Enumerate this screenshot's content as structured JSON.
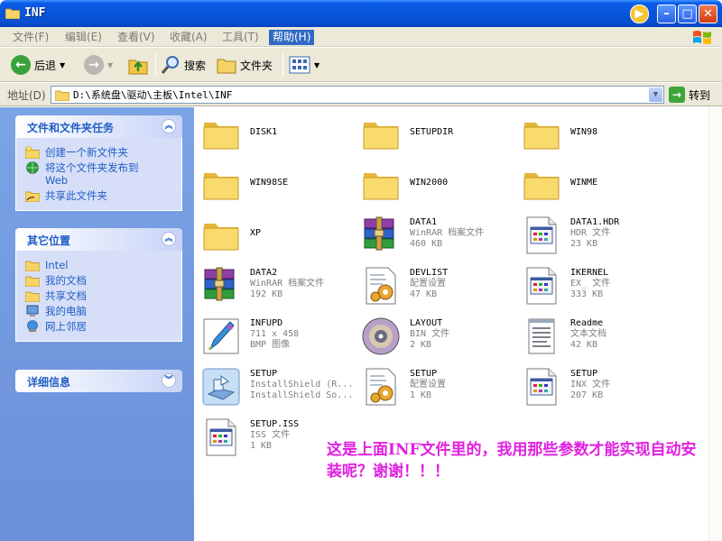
{
  "window": {
    "title": "INF"
  },
  "menu": [
    {
      "label": "文件(F)"
    },
    {
      "label": "编辑(E)"
    },
    {
      "label": "查看(V)"
    },
    {
      "label": "收藏(A)"
    },
    {
      "label": "工具(T)"
    },
    {
      "label": "帮助(H)"
    }
  ],
  "toolbar": {
    "back": "后退",
    "search": "搜索",
    "folders": "文件夹"
  },
  "address": {
    "label": "地址(D)",
    "path": "D:\\系统盘\\驱动\\主板\\Intel\\INF",
    "go": "转到"
  },
  "tasks_panel": {
    "title": "文件和文件夹任务",
    "items": [
      {
        "label": "创建一个新文件夹",
        "icon": "new-folder-icon"
      },
      {
        "label": "将这个文件夹发布到\nWeb",
        "icon": "publish-web-icon"
      },
      {
        "label": "共享此文件夹",
        "icon": "share-folder-icon"
      }
    ]
  },
  "places_panel": {
    "title": "其它位置",
    "items": [
      {
        "label": "Intel",
        "icon": "folder-icon"
      },
      {
        "label": "我的文档",
        "icon": "folder-icon"
      },
      {
        "label": "共享文档",
        "icon": "folder-icon"
      },
      {
        "label": "我的电脑",
        "icon": "computer-icon"
      },
      {
        "label": "网上邻居",
        "icon": "network-icon"
      }
    ]
  },
  "details_panel": {
    "title": "详细信息"
  },
  "files": [
    {
      "name": "DISK1",
      "type": "",
      "size": "",
      "icon": "folder"
    },
    {
      "name": "SETUPDIR",
      "type": "",
      "size": "",
      "icon": "folder"
    },
    {
      "name": "WIN98",
      "type": "",
      "size": "",
      "icon": "folder"
    },
    {
      "name": "WIN98SE",
      "type": "",
      "size": "",
      "icon": "folder"
    },
    {
      "name": "WIN2000",
      "type": "",
      "size": "",
      "icon": "folder"
    },
    {
      "name": "WINME",
      "type": "",
      "size": "",
      "icon": "folder"
    },
    {
      "name": "XP",
      "type": "",
      "size": "",
      "icon": "folder"
    },
    {
      "name": "DATA1",
      "type": "WinRAR 档案文件",
      "size": "460 KB",
      "icon": "rar"
    },
    {
      "name": "DATA1.HDR",
      "type": "HDR 文件",
      "size": "23 KB",
      "icon": "generic"
    },
    {
      "name": "DATA2",
      "type": "WinRAR 档案文件",
      "size": "192 KB",
      "icon": "rar"
    },
    {
      "name": "DEVLIST",
      "type": "配置设置",
      "size": "47 KB",
      "icon": "config"
    },
    {
      "name": "IKERNEL",
      "type": "EX_ 文件",
      "size": "333 KB",
      "icon": "generic"
    },
    {
      "name": "INFUPD",
      "type": "711 x 458",
      "size": "BMP 图像",
      "icon": "bmp"
    },
    {
      "name": "LAYOUT",
      "type": "BIN 文件",
      "size": "2 KB",
      "icon": "disc"
    },
    {
      "name": "Readme",
      "type": "文本文档",
      "size": "42 KB",
      "icon": "text"
    },
    {
      "name": "SETUP",
      "type": "InstallShield (R...",
      "size": "InstallShield So...",
      "icon": "installshield"
    },
    {
      "name": "SETUP",
      "type": "配置设置",
      "size": "1 KB",
      "icon": "config"
    },
    {
      "name": "SETUP",
      "type": "INX 文件",
      "size": "207 KB",
      "icon": "generic"
    },
    {
      "name": "SETUP.ISS",
      "type": "ISS 文件",
      "size": "1 KB",
      "icon": "generic"
    }
  ],
  "annotation": "这是上面INF文件里的，我用那些参数才能实现自动安装呢？谢谢！！！",
  "colors": {
    "title_blue": "#0a54d9",
    "task_pane": "#7ba3e5",
    "annotation": "#e020e0"
  }
}
